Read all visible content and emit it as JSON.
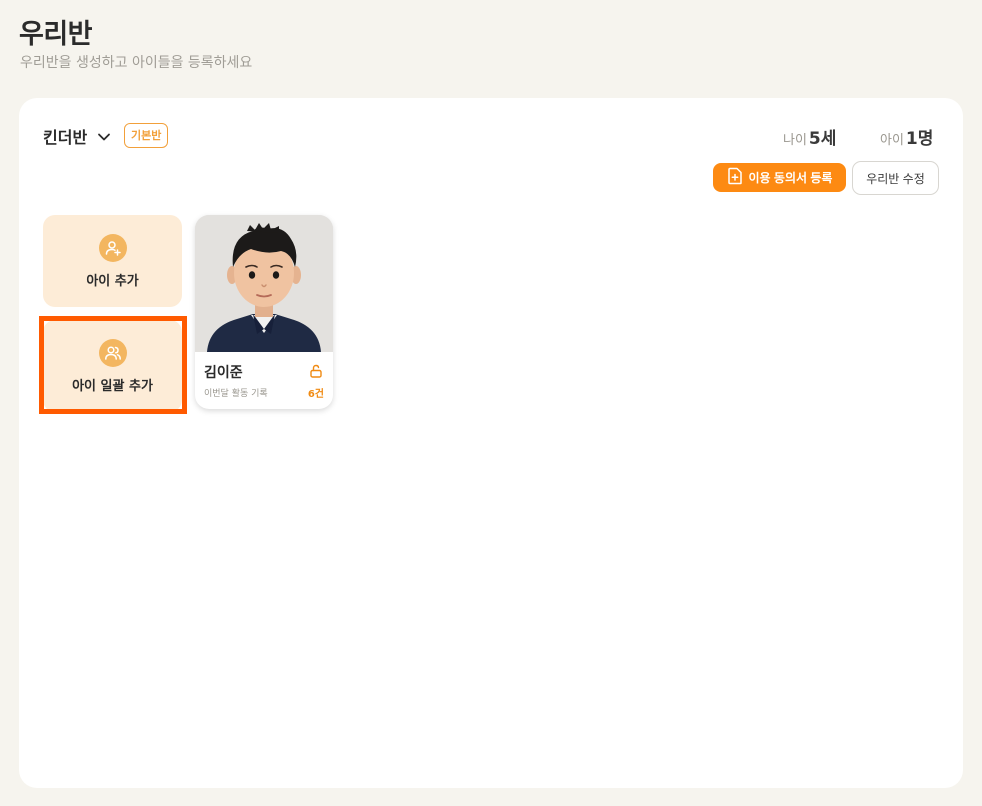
{
  "header": {
    "title": "우리반",
    "subtitle": "우리반을 생성하고 아이들을 등록하세요"
  },
  "class_panel": {
    "class_name": "킨더반",
    "badge": "기본반",
    "age_label": "나이",
    "age_value": "5세",
    "count_label": "아이",
    "count_value": "1명",
    "consent_button": "이용 동의서 등록",
    "edit_button": "우리반 수정"
  },
  "actions": {
    "add_child": "아이 추가",
    "bulk_add": "아이 일괄 추가"
  },
  "children": [
    {
      "name": "김이준",
      "activity_label": "이번달 활동 기록",
      "activity_count": "6건"
    }
  ],
  "colors": {
    "accent": "#fd8a12",
    "tile_bg": "#fdecd7",
    "highlight": "#ff5a00"
  }
}
